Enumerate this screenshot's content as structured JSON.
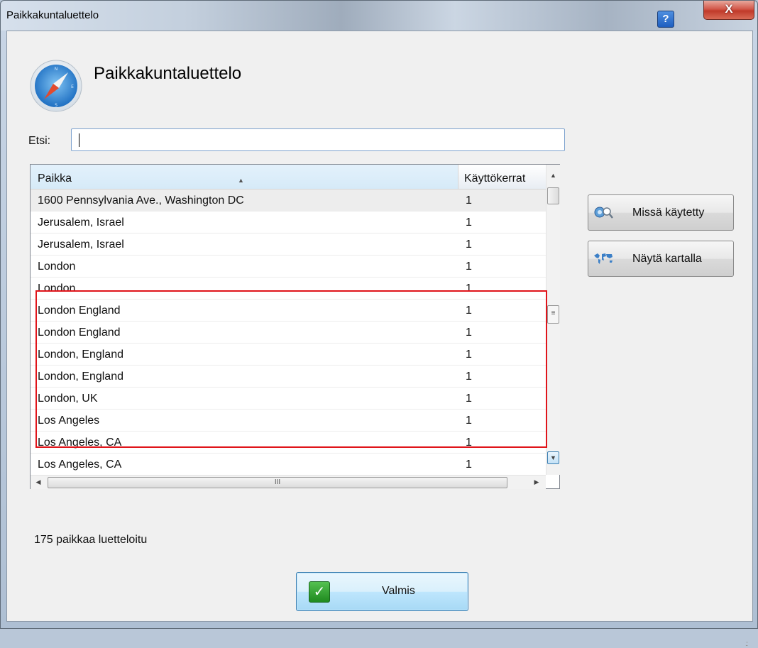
{
  "window": {
    "title": "Paikkakuntaluettelo",
    "help_label": "?",
    "close_label": "X"
  },
  "header": {
    "title": "Paikkakuntaluettelo",
    "icon": "compass-icon"
  },
  "search": {
    "label": "Etsi:",
    "value": "",
    "placeholder": ""
  },
  "table": {
    "columns": [
      "Paikka",
      "Käyttökerrat"
    ],
    "rows": [
      {
        "place": "1600 Pennsylvania Ave., Washington DC",
        "count": "1"
      },
      {
        "place": "Jerusalem, Israel",
        "count": "1"
      },
      {
        "place": "Jerusalem, Israel",
        "count": "1"
      },
      {
        "place": "London",
        "count": "1"
      },
      {
        "place": "London",
        "count": "1"
      },
      {
        "place": "London England",
        "count": "1"
      },
      {
        "place": "London England",
        "count": "1"
      },
      {
        "place": "London, England",
        "count": "1"
      },
      {
        "place": "London, England",
        "count": "1"
      },
      {
        "place": "London, UK",
        "count": "1"
      },
      {
        "place": "Los Angeles",
        "count": "1"
      },
      {
        "place": "Los Angeles, CA",
        "count": "1"
      },
      {
        "place": "Los Angeles, CA",
        "count": "1"
      }
    ]
  },
  "actions": {
    "where_used": "Missä käytetty",
    "show_on_map": "Näytä kartalla"
  },
  "status": {
    "text": "175 paikkaa luetteloitu"
  },
  "footer": {
    "done_label": "Valmis"
  },
  "colors": {
    "highlight": "#e0141a",
    "accent": "#3c7fb1"
  }
}
